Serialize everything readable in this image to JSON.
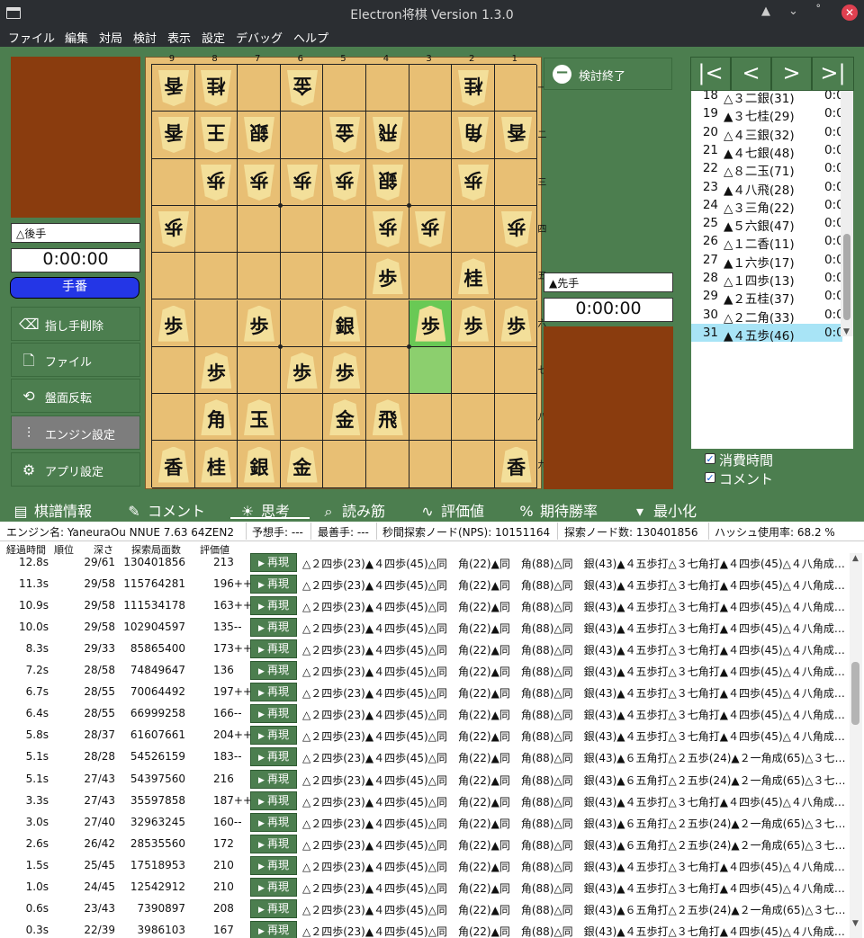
{
  "window": {
    "title": "Electron将棋 Version 1.3.0",
    "controls": [
      "▲",
      "⌄",
      "˚",
      "✕"
    ]
  },
  "menu": [
    "ファイル",
    "編集",
    "対局",
    "検討",
    "表示",
    "設定",
    "デバッグ",
    "ヘルプ"
  ],
  "gote": {
    "name": "△後手",
    "clock": "0:00:00",
    "turn_label": "手番"
  },
  "sente": {
    "name": "▲先手",
    "clock": "0:00:00"
  },
  "left_buttons": [
    {
      "label": "指し手削除",
      "icon": "backspace-icon"
    },
    {
      "label": "ファイル",
      "icon": "file-icon"
    },
    {
      "label": "盤面反転",
      "icon": "flip-icon"
    },
    {
      "label": "エンジン設定",
      "icon": "sliders-icon"
    },
    {
      "label": "アプリ設定",
      "icon": "gear-icon"
    }
  ],
  "board": {
    "file_labels": [
      "9",
      "8",
      "7",
      "6",
      "5",
      "4",
      "3",
      "2",
      "1"
    ],
    "rank_labels": [
      "一",
      "二",
      "三",
      "四",
      "五",
      "六",
      "七",
      "八",
      "九"
    ],
    "last_move_from": [
      6,
      6
    ],
    "last_move_to": [
      5,
      6
    ],
    "pieces": [
      {
        "r": 0,
        "c": 0,
        "k": "香",
        "g": true
      },
      {
        "r": 0,
        "c": 1,
        "k": "桂",
        "g": true
      },
      {
        "r": 0,
        "c": 3,
        "k": "金",
        "g": true
      },
      {
        "r": 0,
        "c": 7,
        "k": "桂",
        "g": true
      },
      {
        "r": 1,
        "c": 0,
        "k": "香",
        "g": true
      },
      {
        "r": 1,
        "c": 1,
        "k": "王",
        "g": true
      },
      {
        "r": 1,
        "c": 2,
        "k": "銀",
        "g": true
      },
      {
        "r": 1,
        "c": 4,
        "k": "金",
        "g": true
      },
      {
        "r": 1,
        "c": 5,
        "k": "飛",
        "g": true
      },
      {
        "r": 1,
        "c": 7,
        "k": "角",
        "g": true
      },
      {
        "r": 1,
        "c": 8,
        "k": "香",
        "g": true
      },
      {
        "r": 2,
        "c": 1,
        "k": "歩",
        "g": true
      },
      {
        "r": 2,
        "c": 2,
        "k": "歩",
        "g": true
      },
      {
        "r": 2,
        "c": 3,
        "k": "歩",
        "g": true
      },
      {
        "r": 2,
        "c": 4,
        "k": "歩",
        "g": true
      },
      {
        "r": 2,
        "c": 5,
        "k": "銀",
        "g": true
      },
      {
        "r": 2,
        "c": 7,
        "k": "歩",
        "g": true
      },
      {
        "r": 3,
        "c": 0,
        "k": "歩",
        "g": true
      },
      {
        "r": 3,
        "c": 5,
        "k": "歩",
        "g": true
      },
      {
        "r": 3,
        "c": 6,
        "k": "歩",
        "g": true
      },
      {
        "r": 3,
        "c": 8,
        "k": "歩",
        "g": true
      },
      {
        "r": 4,
        "c": 5,
        "k": "歩",
        "g": false
      },
      {
        "r": 4,
        "c": 7,
        "k": "桂",
        "g": false
      },
      {
        "r": 5,
        "c": 0,
        "k": "歩",
        "g": false
      },
      {
        "r": 5,
        "c": 2,
        "k": "歩",
        "g": false
      },
      {
        "r": 5,
        "c": 4,
        "k": "銀",
        "g": false
      },
      {
        "r": 5,
        "c": 6,
        "k": "歩",
        "g": false
      },
      {
        "r": 5,
        "c": 7,
        "k": "歩",
        "g": false
      },
      {
        "r": 5,
        "c": 8,
        "k": "歩",
        "g": false
      },
      {
        "r": 6,
        "c": 1,
        "k": "歩",
        "g": false
      },
      {
        "r": 6,
        "c": 3,
        "k": "歩",
        "g": false
      },
      {
        "r": 6,
        "c": 4,
        "k": "歩",
        "g": false
      },
      {
        "r": 7,
        "c": 1,
        "k": "角",
        "g": false
      },
      {
        "r": 7,
        "c": 2,
        "k": "玉",
        "g": false
      },
      {
        "r": 7,
        "c": 4,
        "k": "金",
        "g": false
      },
      {
        "r": 7,
        "c": 5,
        "k": "飛",
        "g": false
      },
      {
        "r": 8,
        "c": 0,
        "k": "香",
        "g": false
      },
      {
        "r": 8,
        "c": 1,
        "k": "桂",
        "g": false
      },
      {
        "r": 8,
        "c": 2,
        "k": "銀",
        "g": false
      },
      {
        "r": 8,
        "c": 3,
        "k": "金",
        "g": false
      },
      {
        "r": 8,
        "c": 8,
        "k": "香",
        "g": false
      }
    ]
  },
  "kentou_button": "検討終了",
  "nav_buttons": [
    "|<",
    "<",
    ">",
    ">|"
  ],
  "records": [
    {
      "n": "18",
      "m": "△３二銀(31)",
      "t": "0:0"
    },
    {
      "n": "19",
      "m": "▲３七桂(29)",
      "t": "0:0"
    },
    {
      "n": "20",
      "m": "△４三銀(32)",
      "t": "0:0"
    },
    {
      "n": "21",
      "m": "▲４七銀(48)",
      "t": "0:0"
    },
    {
      "n": "22",
      "m": "△８二玉(71)",
      "t": "0:0"
    },
    {
      "n": "23",
      "m": "▲４八飛(28)",
      "t": "0:0"
    },
    {
      "n": "24",
      "m": "△３三角(22)",
      "t": "0:0"
    },
    {
      "n": "25",
      "m": "▲５六銀(47)",
      "t": "0:0"
    },
    {
      "n": "26",
      "m": "△１二香(11)",
      "t": "0:0"
    },
    {
      "n": "27",
      "m": "▲１六歩(17)",
      "t": "0:0"
    },
    {
      "n": "28",
      "m": "△１四歩(13)",
      "t": "0:0"
    },
    {
      "n": "29",
      "m": "▲２五桂(37)",
      "t": "0:0"
    },
    {
      "n": "30",
      "m": "△２二角(33)",
      "t": "0:0"
    },
    {
      "n": "31",
      "m": "▲４五歩(46)",
      "t": "0:0"
    }
  ],
  "selected_record": 13,
  "checkboxes": [
    {
      "label": "消費時間",
      "checked": true
    },
    {
      "label": "コメント",
      "checked": true
    }
  ],
  "tabs": [
    {
      "label": "棋譜情報",
      "icon": "document-icon"
    },
    {
      "label": "コメント",
      "icon": "pen-icon"
    },
    {
      "label": "思考",
      "icon": "bulb-icon"
    },
    {
      "label": "読み筋",
      "icon": "search-icon"
    },
    {
      "label": "評価値",
      "icon": "chart-icon"
    },
    {
      "label": "期待勝率",
      "icon": "percent-icon"
    },
    {
      "label": "最小化",
      "icon": "triangle-down-icon"
    }
  ],
  "active_tab": 2,
  "stats": [
    "エンジン名: YaneuraOu NNUE 7.63 64ZEN2",
    "予想手: ---",
    "最善手: ---",
    "秒間探索ノード(NPS): 10151164",
    "探索ノード数: 130401856",
    "ハッシュ使用率: 68.2 %"
  ],
  "pv_headers": [
    "経過時間",
    "順位",
    "深さ",
    "探索局面数",
    "評価値"
  ],
  "replay_label": "再現",
  "pv_rows": [
    {
      "time": "12.8s",
      "rank": "29/61",
      "nodes": "130401856",
      "eval": "213",
      "pv": "△２四歩(23)▲４四歩(45)△同　角(22)▲同　角(88)△同　銀(43)▲４五歩打△３七角打▲４四歩(45)△４八角成…"
    },
    {
      "time": "11.3s",
      "rank": "29/58",
      "nodes": "115764281",
      "eval": "196++",
      "pv": "△２四歩(23)▲４四歩(45)△同　角(22)▲同　角(88)△同　銀(43)▲４五歩打△３七角打▲４四歩(45)△４八角成…"
    },
    {
      "time": "10.9s",
      "rank": "29/58",
      "nodes": "111534178",
      "eval": "163++",
      "pv": "△２四歩(23)▲４四歩(45)△同　角(22)▲同　角(88)△同　銀(43)▲４五歩打△３七角打▲４四歩(45)△４八角成…"
    },
    {
      "time": "10.0s",
      "rank": "29/58",
      "nodes": "102904597",
      "eval": "135--",
      "pv": "△２四歩(23)▲４四歩(45)△同　角(22)▲同　角(88)△同　銀(43)▲４五歩打△３七角打▲４四歩(45)△４八角成…"
    },
    {
      "time": "8.3s",
      "rank": "29/33",
      "nodes": "85865400",
      "eval": "173++",
      "pv": "△２四歩(23)▲４四歩(45)△同　角(22)▲同　角(88)△同　銀(43)▲４五歩打△３七角打▲４四歩(45)△４八角成…"
    },
    {
      "time": "7.2s",
      "rank": "28/58",
      "nodes": "74849647",
      "eval": "136",
      "pv": "△２四歩(23)▲４四歩(45)△同　角(22)▲同　角(88)△同　銀(43)▲４五歩打△３七角打▲４四歩(45)△４八角成…"
    },
    {
      "time": "6.7s",
      "rank": "28/55",
      "nodes": "70064492",
      "eval": "197++",
      "pv": "△２四歩(23)▲４四歩(45)△同　角(22)▲同　角(88)△同　銀(43)▲４五歩打△３七角打▲４四歩(45)△４八角成…"
    },
    {
      "time": "6.4s",
      "rank": "28/55",
      "nodes": "66999258",
      "eval": "166--",
      "pv": "△２四歩(23)▲４四歩(45)△同　角(22)▲同　角(88)△同　銀(43)▲４五歩打△３七角打▲４四歩(45)△４八角成…"
    },
    {
      "time": "5.8s",
      "rank": "28/37",
      "nodes": "61607661",
      "eval": "204++",
      "pv": "△２四歩(23)▲４四歩(45)△同　角(22)▲同　角(88)△同　銀(43)▲４五歩打△３七角打▲４四歩(45)△４八角成…"
    },
    {
      "time": "5.1s",
      "rank": "28/28",
      "nodes": "54526159",
      "eval": "183--",
      "pv": "△２四歩(23)▲４四歩(45)△同　角(22)▲同　角(88)△同　銀(43)▲６五角打△２五歩(24)▲２一角成(65)△３七…"
    },
    {
      "time": "5.1s",
      "rank": "27/43",
      "nodes": "54397560",
      "eval": "216",
      "pv": "△２四歩(23)▲４四歩(45)△同　角(22)▲同　角(88)△同　銀(43)▲６五角打△２五歩(24)▲２一角成(65)△３七…"
    },
    {
      "time": "3.3s",
      "rank": "27/43",
      "nodes": "35597858",
      "eval": "187++",
      "pv": "△２四歩(23)▲４四歩(45)△同　角(22)▲同　角(88)△同　銀(43)▲４五歩打△３七角打▲４四歩(45)△４八角成…"
    },
    {
      "time": "3.0s",
      "rank": "27/40",
      "nodes": "32963245",
      "eval": "160--",
      "pv": "△２四歩(23)▲４四歩(45)△同　角(22)▲同　角(88)△同　銀(43)▲６五角打△２五歩(24)▲２一角成(65)△３七…"
    },
    {
      "time": "2.6s",
      "rank": "26/42",
      "nodes": "28535560",
      "eval": "172",
      "pv": "△２四歩(23)▲４四歩(45)△同　角(22)▲同　角(88)△同　銀(43)▲６五角打△２五歩(24)▲２一角成(65)△３七…"
    },
    {
      "time": "1.5s",
      "rank": "25/45",
      "nodes": "17518953",
      "eval": "210",
      "pv": "△２四歩(23)▲４四歩(45)△同　角(22)▲同　角(88)△同　銀(43)▲４五歩打△３七角打▲４四歩(45)△４八角成…"
    },
    {
      "time": "1.0s",
      "rank": "24/45",
      "nodes": "12542912",
      "eval": "210",
      "pv": "△２四歩(23)▲４四歩(45)△同　角(22)▲同　角(88)△同　銀(43)▲４五歩打△３七角打▲４四歩(45)△４八角成…"
    },
    {
      "time": "0.6s",
      "rank": "23/43",
      "nodes": "7390897",
      "eval": "208",
      "pv": "△２四歩(23)▲４四歩(45)△同　角(22)▲同　角(88)△同　銀(43)▲６五角打△２五歩(24)▲２一角成(65)△３七…"
    },
    {
      "time": "0.3s",
      "rank": "22/39",
      "nodes": "3986103",
      "eval": "167",
      "pv": "△２四歩(23)▲４四歩(45)△同　角(22)▲同　角(88)△同　銀(43)▲４五歩打△３七角打▲４四歩(45)△４八角成…"
    }
  ],
  "colors": {
    "panel_green": "#4c7e4f",
    "stand_brown": "#8a3c0e",
    "board_wood": "#e8bf74",
    "highlight_to": "#69c955",
    "highlight_from": "#8ccf6e",
    "turn_blue": "#2436e6",
    "selected_row": "#a8e4f6"
  }
}
